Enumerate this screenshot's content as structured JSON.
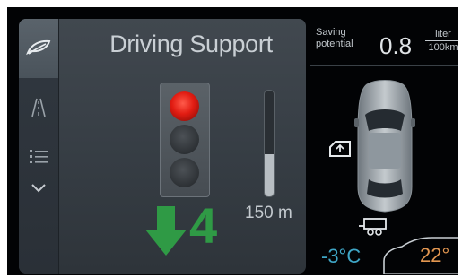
{
  "driving_support": {
    "title": "Driving Support",
    "distance": "150 m",
    "gear": "4",
    "gear_direction": "down",
    "gear_arrow_color": "#2f9a45",
    "traffic_light_state": "red",
    "distance_bar_level": 0.4
  },
  "sidebar": {
    "items": [
      {
        "icon": "leaf-icon",
        "selected": true
      },
      {
        "icon": "road-icon",
        "selected": false
      },
      {
        "icon": "list-icon",
        "selected": false
      },
      {
        "icon": "chevron-down-icon",
        "selected": false
      }
    ]
  },
  "saving": {
    "label": "Saving potential",
    "value": "0.8",
    "unit_numerator": "liter",
    "unit_denominator": "100km"
  },
  "vehicle": {
    "icons": [
      "car-topview-icon",
      "window-icon",
      "trailer-icon"
    ]
  },
  "climate": {
    "outside_temp": "-3°C",
    "inside_temp": "22°",
    "outside_color": "#3fa6c6",
    "inside_color": "#e29650"
  }
}
